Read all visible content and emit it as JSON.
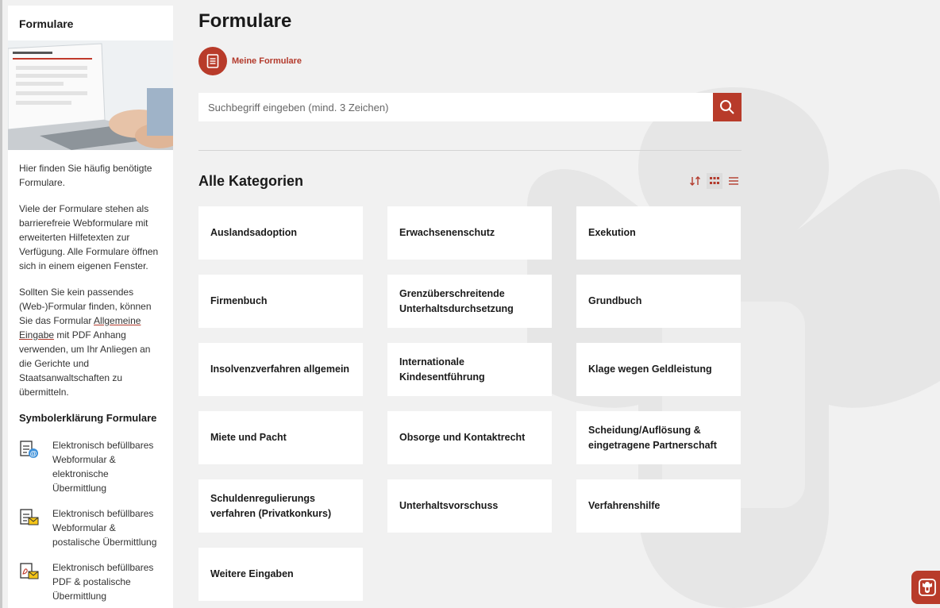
{
  "sidebar": {
    "title": "Formulare",
    "intro": "Hier finden Sie häufig benötigte Formulare.",
    "paragraph2": "Viele der Formulare stehen als barrierefreie Webformulare mit erweiterten Hilfetexten zur Verfügung. Alle Formulare öffnen sich in einem eigenen Fenster.",
    "paragraph3_before": "Sollten Sie kein passendes (Web-)Formular finden, können Sie das Formular ",
    "paragraph3_link": "Allgemeine Eingabe",
    "paragraph3_after": " mit PDF Anhang verwenden, um Ihr Anliegen an die Gerichte und Staatsanwaltschaften zu übermitteln.",
    "legend_title": "Symbolerklärung Formulare",
    "legend": [
      {
        "icon": "webform-electronic-icon",
        "text": "Elektronisch befüllbares Webformular & elektronische Übermittlung"
      },
      {
        "icon": "webform-postal-icon",
        "text": "Elektronisch befüllbares Webformular & postalische Übermittlung"
      },
      {
        "icon": "pdf-postal-icon",
        "text": "Elektronisch befüllbares PDF & postalische Übermittlung"
      }
    ]
  },
  "main": {
    "title": "Formulare",
    "my_forms_label": "Meine Formulare",
    "search_placeholder": "Suchbegriff eingeben (mind. 3 Zeichen)",
    "categories_title": "Alle Kategorien",
    "categories": [
      "Auslandsadoption",
      "Erwachsenenschutz",
      "Exekution",
      "Firmenbuch",
      "Grenzüberschreitende Unterhaltsdurchsetzung",
      "Grundbuch",
      "Insolvenzverfahren allgemein",
      "Internationale Kindesentführung",
      "Klage wegen Geldleistung",
      "Miete und Pacht",
      "Obsorge und Kontaktrecht",
      "Scheidung/Auflösung & eingetragene Partnerschaft",
      "Schuldenregulierungs verfahren (Privatkonkurs)",
      "Unterhaltsvorschuss",
      "Verfahrenshilfe",
      "Weitere Eingaben"
    ]
  },
  "colors": {
    "accent": "#b83b2a",
    "background": "#f1f1f1"
  }
}
